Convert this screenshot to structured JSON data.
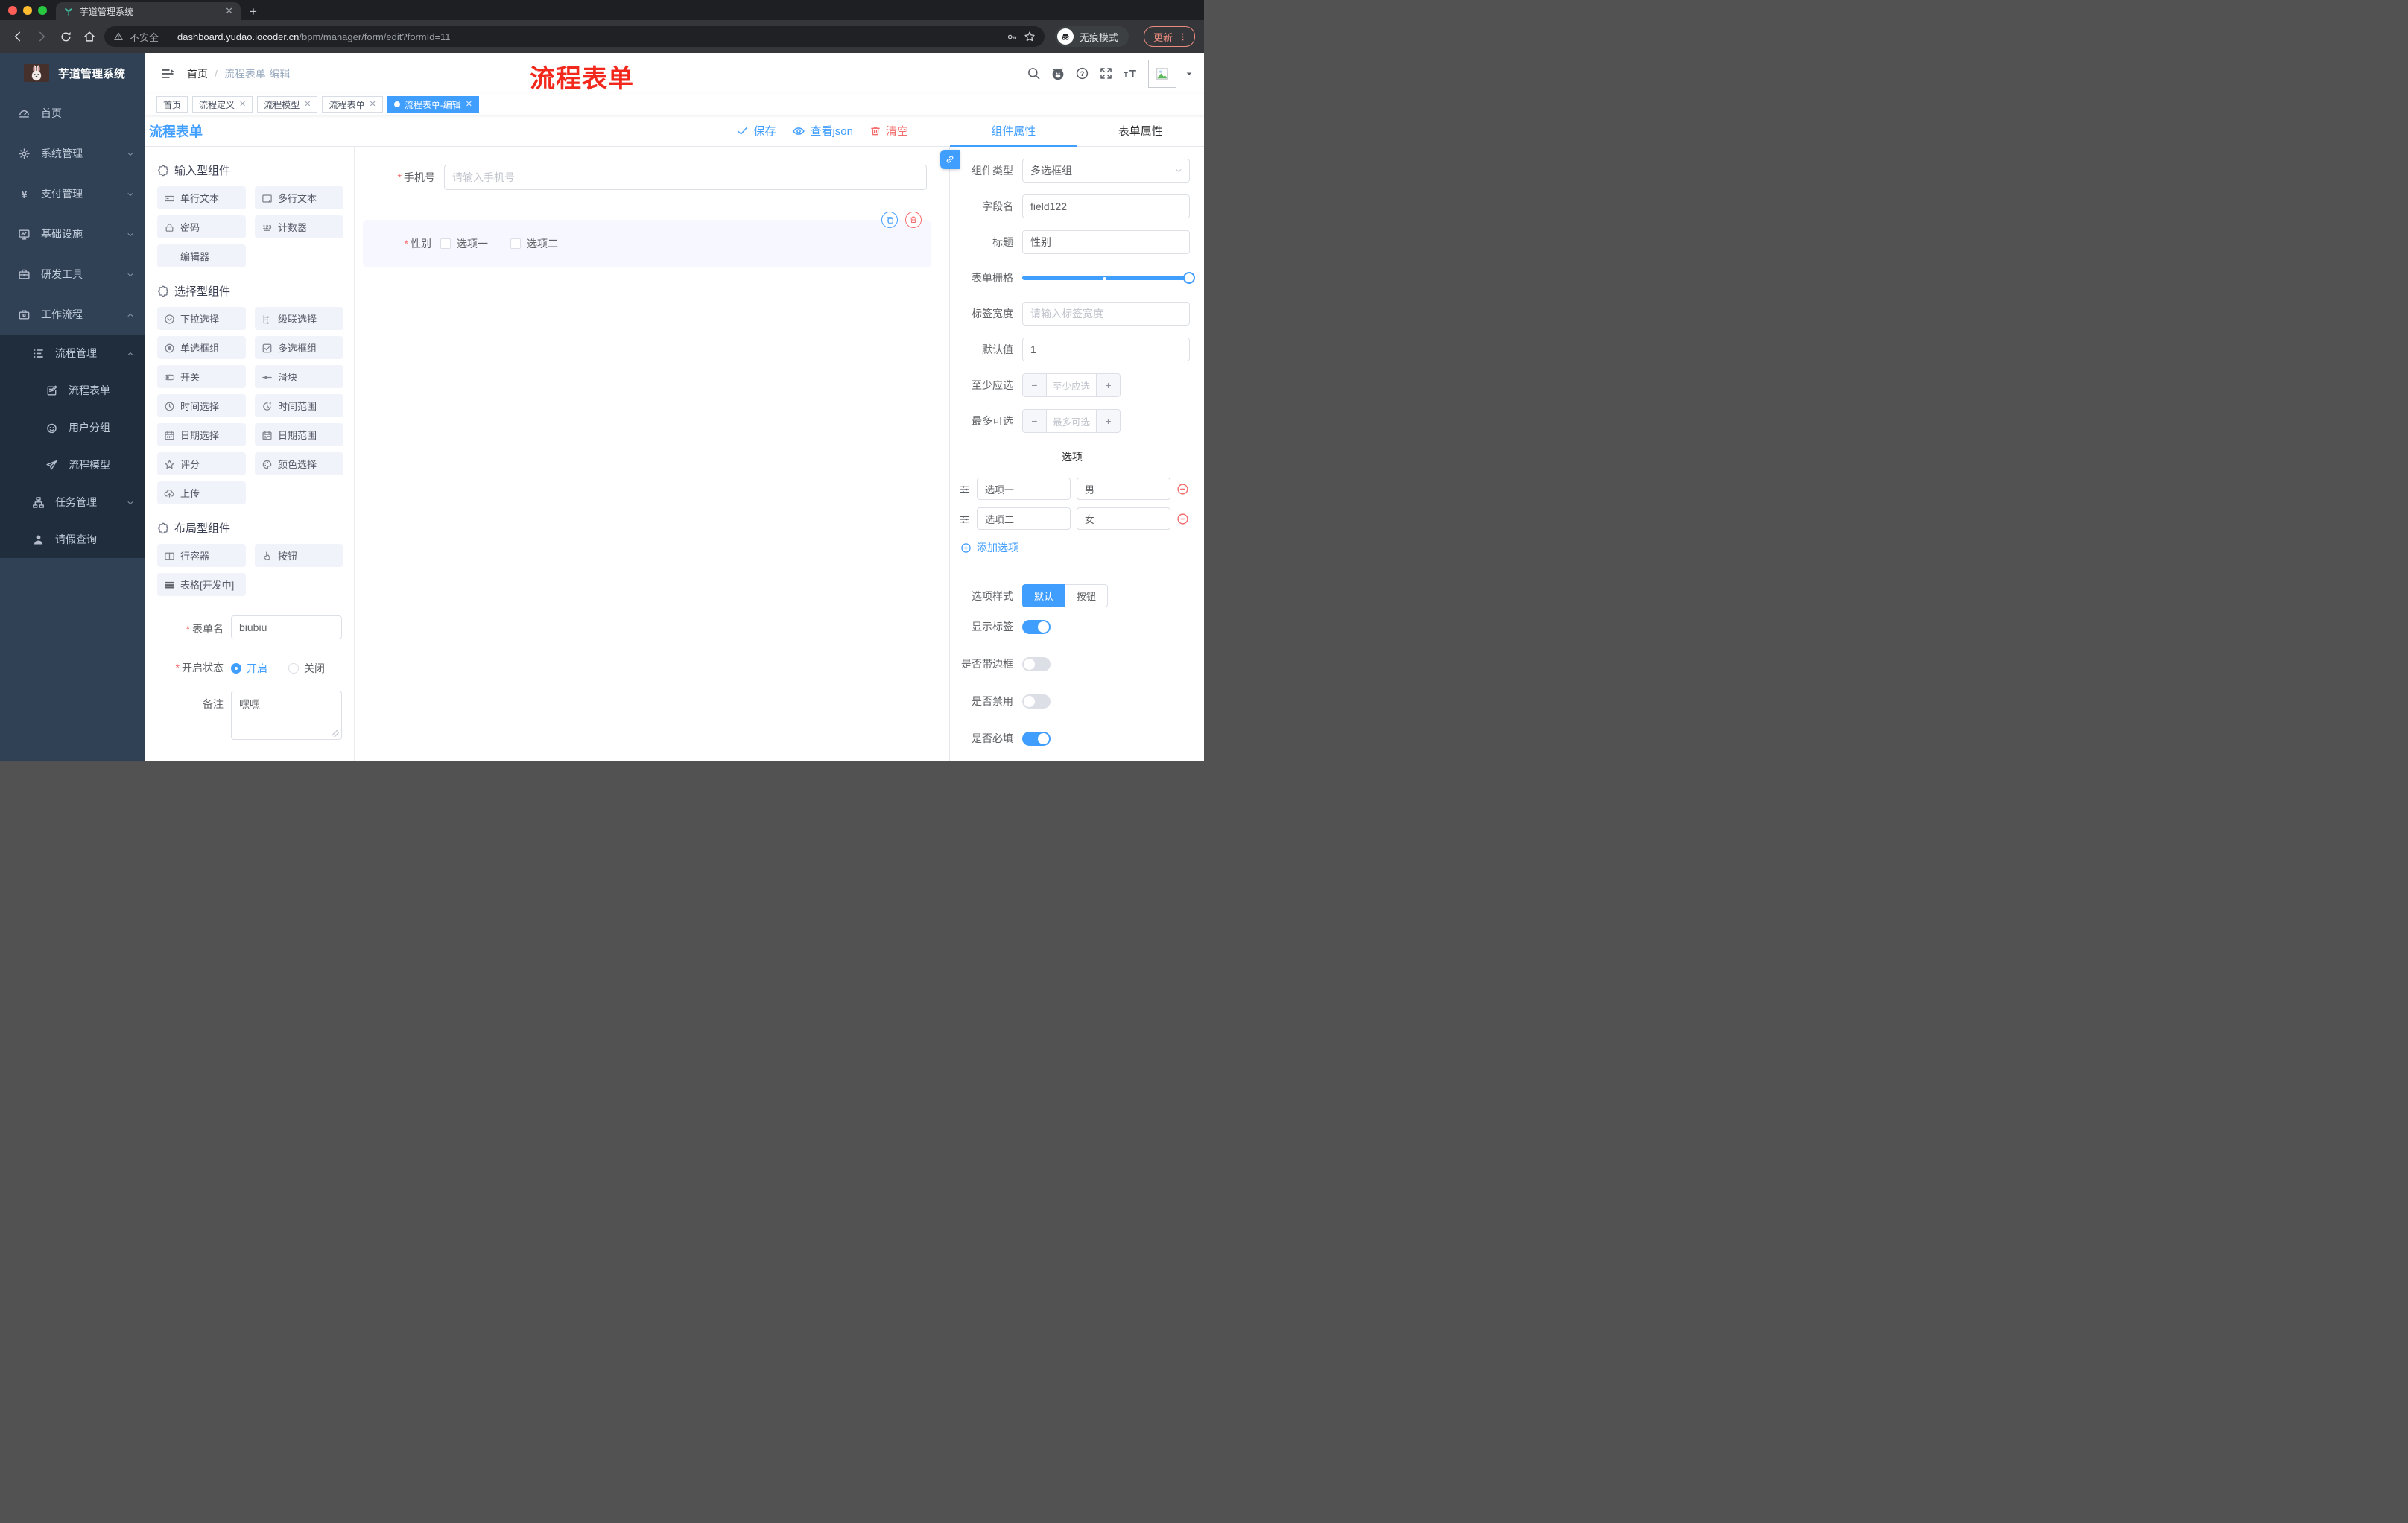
{
  "browser": {
    "tab_title": "芋道管理系统",
    "close_tab": "✕",
    "security_text": "不安全",
    "url_domain": "dashboard.yudao.iocoder.cn",
    "url_path": "/bpm/manager/form/edit?formId=11",
    "incognito_label": "无痕模式",
    "update_label": "更新"
  },
  "sidebar": {
    "logo_title": "芋道管理系统",
    "items": [
      {
        "icon": "dashboard",
        "label": "首页",
        "level": 1,
        "chevron": ""
      },
      {
        "icon": "gear",
        "label": "系统管理",
        "level": 1,
        "chevron": "down"
      },
      {
        "icon": "yen",
        "label": "支付管理",
        "level": 1,
        "chevron": "down"
      },
      {
        "icon": "monitor",
        "label": "基础设施",
        "level": 1,
        "chevron": "down"
      },
      {
        "icon": "toolbox",
        "label": "研发工具",
        "level": 1,
        "chevron": "down"
      },
      {
        "icon": "briefcase",
        "label": "工作流程",
        "level": 1,
        "chevron": "up"
      },
      {
        "icon": "list",
        "label": "流程管理",
        "level": 2,
        "chevron": "up"
      },
      {
        "icon": "doc-edit",
        "label": "流程表单",
        "level": 3,
        "chevron": ""
      },
      {
        "icon": "face",
        "label": "用户分组",
        "level": 3,
        "chevron": ""
      },
      {
        "icon": "plane",
        "label": "流程模型",
        "level": 3,
        "chevron": ""
      },
      {
        "icon": "tree",
        "label": "任务管理",
        "level": 2,
        "chevron": "down"
      },
      {
        "icon": "person",
        "label": "请假查询",
        "level": 2,
        "chevron": ""
      }
    ]
  },
  "navbar": {
    "breadcrumb_home": "首页",
    "breadcrumb_sep": "/",
    "breadcrumb_current": "流程表单-编辑",
    "annotation": "流程表单"
  },
  "tags": [
    {
      "label": "首页",
      "closable": false,
      "active": false
    },
    {
      "label": "流程定义",
      "closable": true,
      "active": false
    },
    {
      "label": "流程模型",
      "closable": true,
      "active": false
    },
    {
      "label": "流程表单",
      "closable": true,
      "active": false
    },
    {
      "label": "流程表单-编辑",
      "closable": true,
      "active": true
    }
  ],
  "page_header": {
    "title": "流程表单",
    "save_label": "保存",
    "view_json_label": "查看json",
    "clear_label": "清空"
  },
  "components": {
    "sections": [
      {
        "title": "输入型组件",
        "items": [
          {
            "label": "单行文本",
            "icon": "input"
          },
          {
            "label": "多行文本",
            "icon": "textarea"
          },
          {
            "label": "密码",
            "icon": "lock"
          },
          {
            "label": "计数器",
            "icon": "counter"
          },
          {
            "label": "编辑器",
            "icon": ""
          }
        ]
      },
      {
        "title": "选择型组件",
        "items": [
          {
            "label": "下拉选择",
            "icon": "select"
          },
          {
            "label": "级联选择",
            "icon": "cascade"
          },
          {
            "label": "单选框组",
            "icon": "radio"
          },
          {
            "label": "多选框组",
            "icon": "checkbox"
          },
          {
            "label": "开关",
            "icon": "switch"
          },
          {
            "label": "滑块",
            "icon": "slider"
          },
          {
            "label": "时间选择",
            "icon": "clock"
          },
          {
            "label": "时间范围",
            "icon": "timerange"
          },
          {
            "label": "日期选择",
            "icon": "date"
          },
          {
            "label": "日期范围",
            "icon": "daterange"
          },
          {
            "label": "评分",
            "icon": "star"
          },
          {
            "label": "颜色选择",
            "icon": "palette"
          },
          {
            "label": "上传",
            "icon": "upload"
          }
        ]
      },
      {
        "title": "布局型组件",
        "items": [
          {
            "label": "行容器",
            "icon": "row"
          },
          {
            "label": "按钮",
            "icon": "button"
          },
          {
            "label": "表格[开发中]",
            "icon": "table"
          }
        ]
      }
    ],
    "form": {
      "name_label": "表单名",
      "name_value": "biubiu",
      "status_label": "开启状态",
      "status_on": "开启",
      "status_off": "关闭",
      "remark_label": "备注",
      "remark_value": "嘿嘿"
    }
  },
  "canvas": {
    "phone": {
      "label": "手机号",
      "placeholder": "请输入手机号"
    },
    "gender": {
      "label": "性别",
      "options": [
        "选项一",
        "选项二"
      ]
    }
  },
  "panel": {
    "tabs": [
      "组件属性",
      "表单属性"
    ],
    "fields": {
      "type_label": "组件类型",
      "type_value": "多选框组",
      "field_label": "字段名",
      "field_value": "field122",
      "title_label": "标题",
      "title_value": "性别",
      "grid_label": "表单栅格",
      "labelw_label": "标签宽度",
      "labelw_placeholder": "请输入标签宽度",
      "default_label": "默认值",
      "default_value": "1",
      "min_label": "至少应选",
      "min_placeholder": "至少应选",
      "max_label": "最多可选",
      "max_placeholder": "最多可选"
    },
    "options": {
      "divider_title": "选项",
      "rows": [
        {
          "label": "选项一",
          "value": "男"
        },
        {
          "label": "选项二",
          "value": "女"
        }
      ],
      "add_label": "添加选项"
    },
    "style": {
      "label": "选项样式",
      "choices": [
        "默认",
        "按钮"
      ],
      "active": 0
    },
    "switches": [
      {
        "label": "显示标签",
        "on": true
      },
      {
        "label": "是否带边框",
        "on": false
      },
      {
        "label": "是否禁用",
        "on": false
      },
      {
        "label": "是否必填",
        "on": true
      }
    ]
  },
  "colors": {
    "primary": "#409eff",
    "danger": "#f56c6c",
    "annotation": "#f2281d",
    "sidebar_bg": "#304156",
    "sidebar_sub_bg": "#1f2d3d",
    "active_tag_bg": "#409eff"
  }
}
